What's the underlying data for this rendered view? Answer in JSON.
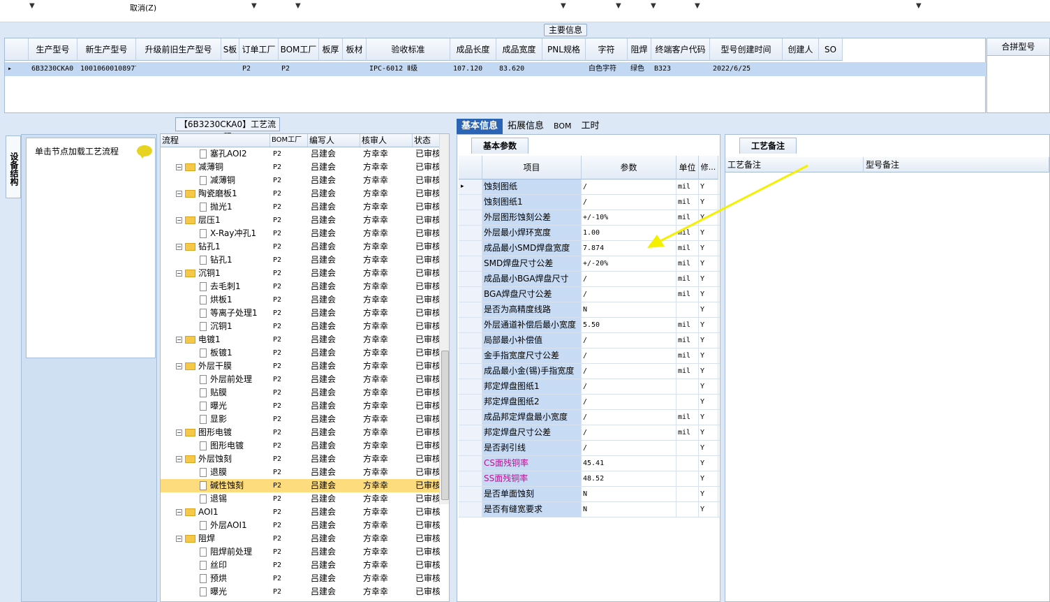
{
  "toolbar": {
    "cancel_label": "取消(Z)"
  },
  "main_info": {
    "title": "主要信息",
    "columns": [
      "生产型号",
      "新生产型号",
      "升级前旧生产型号",
      "S板",
      "订单工厂",
      "BOM工厂",
      "板厚",
      "板材",
      "验收标准",
      "成品长度",
      "成品宽度",
      "PNL规格",
      "字符",
      "阻焊",
      "终端客户代码",
      "型号创建时间",
      "创建人",
      "SO"
    ],
    "row": [
      "6B3230CKA0",
      "10010600108977",
      "",
      "",
      "P2",
      "P2",
      "",
      "",
      "IPC-6012 Ⅱ级",
      "107.120",
      "83.620",
      "",
      "白色字符",
      "绿色",
      "B323",
      "2022/6/25",
      "",
      ""
    ],
    "merge_header": "合拼型号"
  },
  "left_panel": {
    "vertical_tab": "设备结构",
    "hint": "单击节点加载工艺流程"
  },
  "process": {
    "title": "【6B3230CKA0】工艺流程",
    "columns": [
      "流程",
      "BOM工厂",
      "编写人",
      "核审人",
      "状态"
    ],
    "rows": [
      {
        "name": "塞孔AOI2",
        "type": "child",
        "factory": "P2",
        "writer": "吕建会",
        "reviewer": "方幸幸",
        "status": "已审核"
      },
      {
        "name": "减薄铜",
        "type": "folder",
        "factory": "P2",
        "writer": "吕建会",
        "reviewer": "方幸幸",
        "status": "已审核"
      },
      {
        "name": "减薄铜",
        "type": "child",
        "factory": "P2",
        "writer": "吕建会",
        "reviewer": "方幸幸",
        "status": "已审核"
      },
      {
        "name": "陶瓷磨板1",
        "type": "folder",
        "factory": "P2",
        "writer": "吕建会",
        "reviewer": "方幸幸",
        "status": "已审核"
      },
      {
        "name": "抛光1",
        "type": "child",
        "factory": "P2",
        "writer": "吕建会",
        "reviewer": "方幸幸",
        "status": "已审核"
      },
      {
        "name": "层压1",
        "type": "folder",
        "factory": "P2",
        "writer": "吕建会",
        "reviewer": "方幸幸",
        "status": "已审核"
      },
      {
        "name": "X-Ray冲孔1",
        "type": "child",
        "factory": "P2",
        "writer": "吕建会",
        "reviewer": "方幸幸",
        "status": "已审核"
      },
      {
        "name": "钻孔1",
        "type": "folder",
        "factory": "P2",
        "writer": "吕建会",
        "reviewer": "方幸幸",
        "status": "已审核"
      },
      {
        "name": "钻孔1",
        "type": "child",
        "factory": "P2",
        "writer": "吕建会",
        "reviewer": "方幸幸",
        "status": "已审核"
      },
      {
        "name": "沉铜1",
        "type": "folder",
        "factory": "P2",
        "writer": "吕建会",
        "reviewer": "方幸幸",
        "status": "已审核"
      },
      {
        "name": "去毛刺1",
        "type": "child",
        "factory": "P2",
        "writer": "吕建会",
        "reviewer": "方幸幸",
        "status": "已审核"
      },
      {
        "name": "烘板1",
        "type": "child",
        "factory": "P2",
        "writer": "吕建会",
        "reviewer": "方幸幸",
        "status": "已审核"
      },
      {
        "name": "等离子处理1",
        "type": "child",
        "factory": "P2",
        "writer": "吕建会",
        "reviewer": "方幸幸",
        "status": "已审核"
      },
      {
        "name": "沉铜1",
        "type": "child",
        "factory": "P2",
        "writer": "吕建会",
        "reviewer": "方幸幸",
        "status": "已审核"
      },
      {
        "name": "电镀1",
        "type": "folder",
        "factory": "P2",
        "writer": "吕建会",
        "reviewer": "方幸幸",
        "status": "已审核"
      },
      {
        "name": "板镀1",
        "type": "child",
        "factory": "P2",
        "writer": "吕建会",
        "reviewer": "方幸幸",
        "status": "已审核"
      },
      {
        "name": "外层干膜",
        "type": "folder",
        "factory": "P2",
        "writer": "吕建会",
        "reviewer": "方幸幸",
        "status": "已审核"
      },
      {
        "name": "外层前处理",
        "type": "child",
        "factory": "P2",
        "writer": "吕建会",
        "reviewer": "方幸幸",
        "status": "已审核"
      },
      {
        "name": "贴膜",
        "type": "child",
        "factory": "P2",
        "writer": "吕建会",
        "reviewer": "方幸幸",
        "status": "已审核"
      },
      {
        "name": "曝光",
        "type": "child",
        "factory": "P2",
        "writer": "吕建会",
        "reviewer": "方幸幸",
        "status": "已审核"
      },
      {
        "name": "显影",
        "type": "child",
        "factory": "P2",
        "writer": "吕建会",
        "reviewer": "方幸幸",
        "status": "已审核"
      },
      {
        "name": "图形电镀",
        "type": "folder",
        "factory": "P2",
        "writer": "吕建会",
        "reviewer": "方幸幸",
        "status": "已审核"
      },
      {
        "name": "图形电镀",
        "type": "child",
        "factory": "P2",
        "writer": "吕建会",
        "reviewer": "方幸幸",
        "status": "已审核"
      },
      {
        "name": "外层蚀刻",
        "type": "folder",
        "factory": "P2",
        "writer": "吕建会",
        "reviewer": "方幸幸",
        "status": "已审核"
      },
      {
        "name": "退膜",
        "type": "child",
        "factory": "P2",
        "writer": "吕建会",
        "reviewer": "方幸幸",
        "status": "已审核"
      },
      {
        "name": "碱性蚀刻",
        "type": "child",
        "factory": "P2",
        "writer": "吕建会",
        "reviewer": "方幸幸",
        "status": "已审核",
        "selected": true
      },
      {
        "name": "退锡",
        "type": "child",
        "factory": "P2",
        "writer": "吕建会",
        "reviewer": "方幸幸",
        "status": "已审核"
      },
      {
        "name": "AOI1",
        "type": "folder",
        "factory": "P2",
        "writer": "吕建会",
        "reviewer": "方幸幸",
        "status": "已审核"
      },
      {
        "name": "外层AOI1",
        "type": "child",
        "factory": "P2",
        "writer": "吕建会",
        "reviewer": "方幸幸",
        "status": "已审核"
      },
      {
        "name": "阻焊",
        "type": "folder",
        "factory": "P2",
        "writer": "吕建会",
        "reviewer": "方幸幸",
        "status": "已审核"
      },
      {
        "name": "阻焊前处理",
        "type": "child",
        "factory": "P2",
        "writer": "吕建会",
        "reviewer": "方幸幸",
        "status": "已审核"
      },
      {
        "name": "丝印",
        "type": "child",
        "factory": "P2",
        "writer": "吕建会",
        "reviewer": "方幸幸",
        "status": "已审核"
      },
      {
        "name": "预烘",
        "type": "child",
        "factory": "P2",
        "writer": "吕建会",
        "reviewer": "方幸幸",
        "status": "已审核"
      },
      {
        "name": "曝光",
        "type": "child",
        "factory": "P2",
        "writer": "吕建会",
        "reviewer": "方幸幸",
        "status": "已审核"
      }
    ]
  },
  "tabs": [
    "基本信息",
    "拓展信息",
    "BOM",
    "工时"
  ],
  "params": {
    "tab": "基本参数",
    "columns": [
      "项目",
      "参数",
      "单位",
      "修..."
    ],
    "rows": [
      {
        "item": "蚀刻图纸",
        "value": "/",
        "unit": "mil",
        "mod": "Y"
      },
      {
        "item": "蚀刻图纸1",
        "value": "/",
        "unit": "mil",
        "mod": "Y"
      },
      {
        "item": "外层图形蚀刻公差",
        "value": "+/-10%",
        "unit": "mil",
        "mod": "Y"
      },
      {
        "item": "外层最小焊环宽度",
        "value": "1.00",
        "unit": "mil",
        "mod": "Y"
      },
      {
        "item": "成品最小SMD焊盘宽度",
        "value": "7.874",
        "unit": "mil",
        "mod": "Y"
      },
      {
        "item": "SMD焊盘尺寸公差",
        "value": "+/-20%",
        "unit": "mil",
        "mod": "Y"
      },
      {
        "item": "成品最小BGA焊盘尺寸",
        "value": "/",
        "unit": "mil",
        "mod": "Y"
      },
      {
        "item": "BGA焊盘尺寸公差",
        "value": "/",
        "unit": "mil",
        "mod": "Y"
      },
      {
        "item": "是否为高精度线路",
        "value": "N",
        "unit": "",
        "mod": "Y"
      },
      {
        "item": "外层通道补偿后最小宽度",
        "value": "5.50",
        "unit": "mil",
        "mod": "Y"
      },
      {
        "item": "局部最小补偿值",
        "value": "/",
        "unit": "mil",
        "mod": "Y"
      },
      {
        "item": "金手指宽度尺寸公差",
        "value": "/",
        "unit": "mil",
        "mod": "Y"
      },
      {
        "item": "成品最小金(锡)手指宽度",
        "value": "/",
        "unit": "mil",
        "mod": "Y"
      },
      {
        "item": "邦定焊盘图纸1",
        "value": "/",
        "unit": "",
        "mod": "Y"
      },
      {
        "item": "邦定焊盘图纸2",
        "value": "/",
        "unit": "",
        "mod": "Y"
      },
      {
        "item": "成品邦定焊盘最小宽度",
        "value": "/",
        "unit": "mil",
        "mod": "Y"
      },
      {
        "item": "邦定焊盘尺寸公差",
        "value": "/",
        "unit": "mil",
        "mod": "Y"
      },
      {
        "item": "是否剥引线",
        "value": "/",
        "unit": "",
        "mod": "Y"
      },
      {
        "item": "CS面残铜率",
        "value": "45.41",
        "unit": "",
        "mod": "Y",
        "highlight": true
      },
      {
        "item": "SS面残铜率",
        "value": "48.52",
        "unit": "",
        "mod": "Y",
        "highlight": true
      },
      {
        "item": "是否单面蚀刻",
        "value": "N",
        "unit": "",
        "mod": "Y"
      },
      {
        "item": "是否有缝宽要求",
        "value": "N",
        "unit": "",
        "mod": "Y"
      }
    ]
  },
  "notes": {
    "tab": "工艺备注",
    "col1": "工艺备注",
    "col2": "型号备注"
  },
  "colors": {
    "accent": "#2b63b5",
    "selected_row": "#c3d9f3",
    "tree_selected": "#fddc7e",
    "arrow": "#f5f000",
    "highlight_text": "#b0178f"
  }
}
